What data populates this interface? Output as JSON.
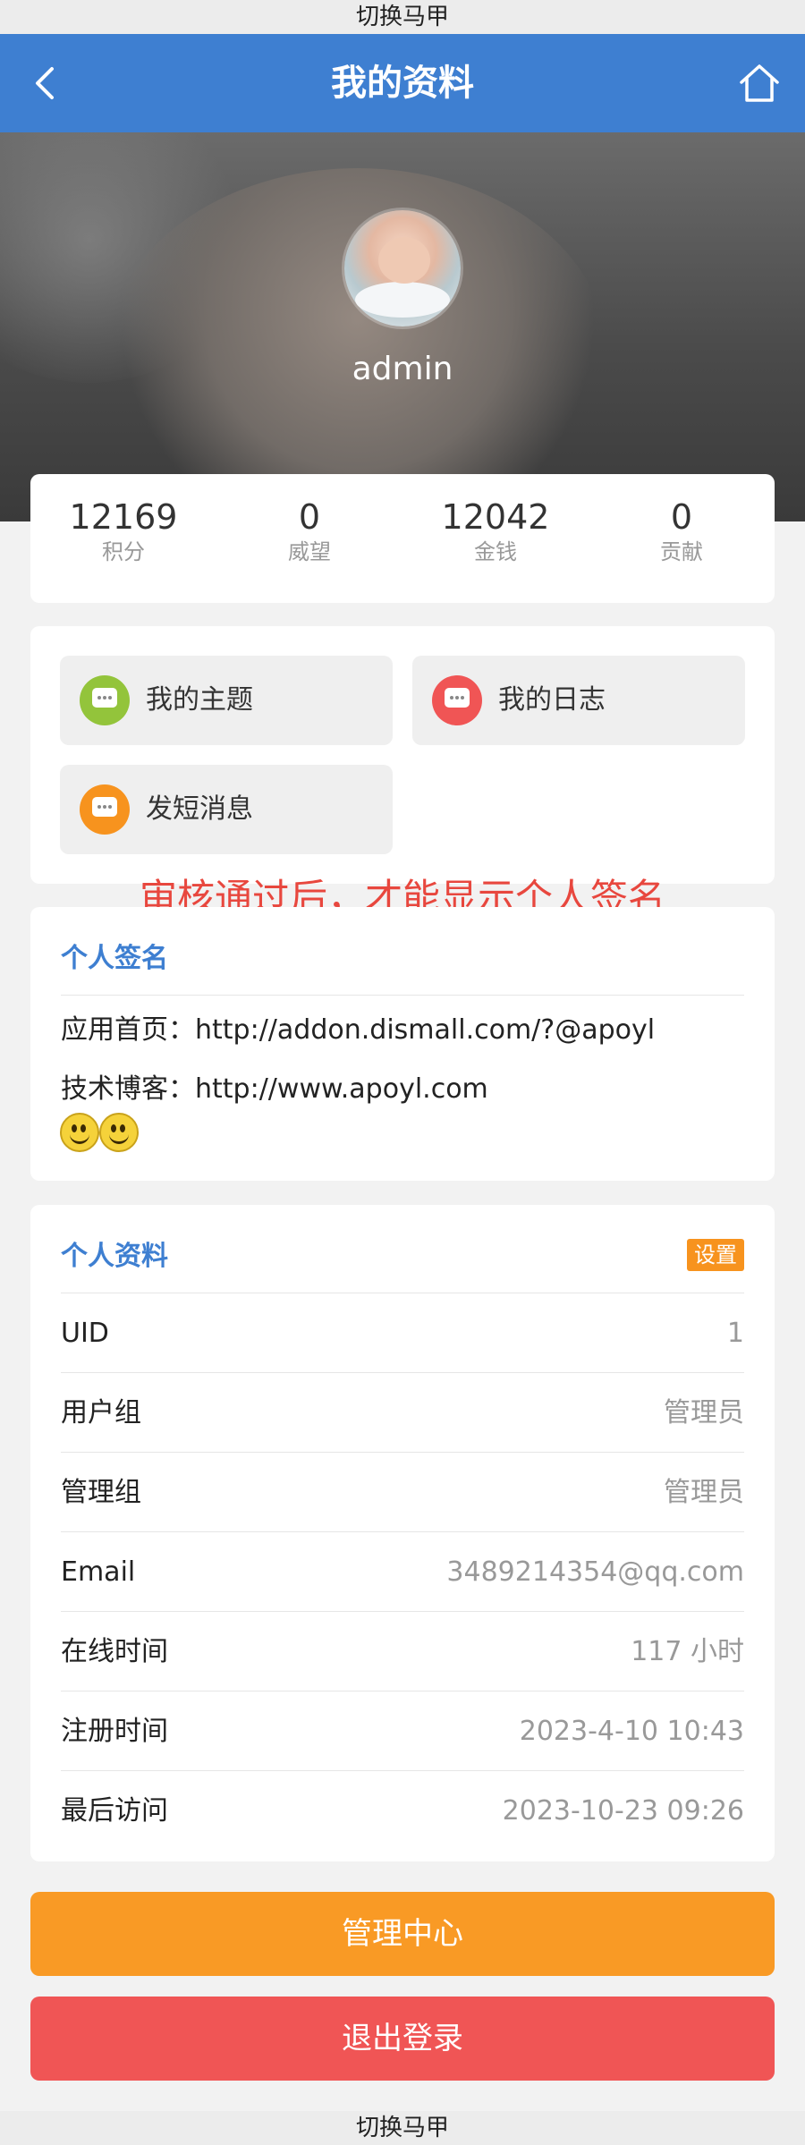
{
  "top_banner": "切换马甲",
  "header": {
    "title": "我的资料"
  },
  "profile_header": {
    "username": "admin"
  },
  "stats": [
    {
      "value": "12169",
      "label": "积分"
    },
    {
      "value": "0",
      "label": "威望"
    },
    {
      "value": "12042",
      "label": "金钱"
    },
    {
      "value": "0",
      "label": "贡献"
    }
  ],
  "menu": [
    {
      "label": "我的主题",
      "icon": "chat-bubble-icon",
      "color": "#93c43b"
    },
    {
      "label": "我的日志",
      "icon": "message-icon",
      "color": "#f05555"
    },
    {
      "label": "发短消息",
      "icon": "chat-icon",
      "color": "#f7931e"
    }
  ],
  "notice": "审核通过后，才能显示个人签名",
  "signature": {
    "title": "个人签名",
    "lines": [
      "应用首页：http://addon.dismall.com/?@apoyl",
      "技术博客：http://www.apoyl.com"
    ]
  },
  "profile": {
    "title": "个人资料",
    "settings_label": "设置",
    "rows": [
      {
        "key": "UID",
        "value": "1"
      },
      {
        "key": "用户组",
        "value": "管理员"
      },
      {
        "key": "管理组",
        "value": "管理员"
      },
      {
        "key": "Email",
        "value": "3489214354@qq.com"
      },
      {
        "key": "在线时间",
        "value": "117 小时"
      },
      {
        "key": "注册时间",
        "value": "2023-4-10 10:43"
      },
      {
        "key": "最后访问",
        "value": "2023-10-23 09:26"
      }
    ]
  },
  "buttons": {
    "admin": "管理中心",
    "logout": "退出登录"
  },
  "bottom_banner": "切换马甲",
  "colors": {
    "header": "#3e7fd1",
    "admin_button": "#f99a25",
    "logout_button": "#f05555",
    "notice": "#e8473e"
  }
}
